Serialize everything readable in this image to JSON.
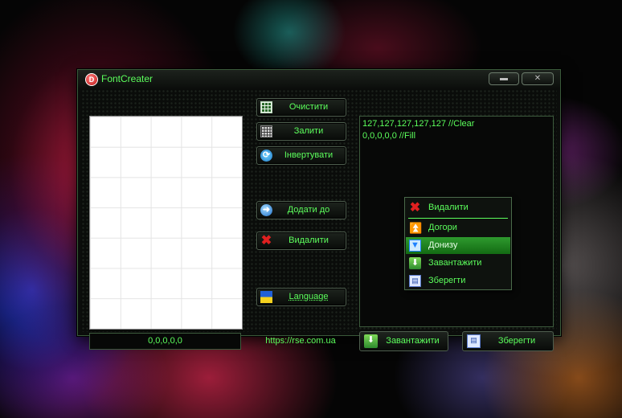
{
  "window": {
    "title": "FontCreater",
    "app_icon_glyph": "D",
    "minimize_glyph": "▬",
    "close_glyph": "✕"
  },
  "canvas": {
    "value": "0,0,0,0,0"
  },
  "buttons": {
    "clear": {
      "label": "Очистити",
      "icon": "table-icon"
    },
    "fill": {
      "label": "Залити",
      "icon": "grid-icon"
    },
    "invert": {
      "label": "Інвертувати",
      "icon": "refresh-icon"
    },
    "add_to": {
      "label": "Додати до",
      "icon": "arrow-right-icon"
    },
    "delete": {
      "label": "Видалити",
      "icon": "close-x-icon"
    },
    "language": {
      "label": "Language",
      "icon": "ukraine-flag-icon"
    }
  },
  "website": "https://rse.com.ua",
  "code": {
    "lines": [
      "127,127,127,127,127 //Clear",
      "0,0,0,0,0 //Fill"
    ]
  },
  "context_menu": {
    "items": [
      {
        "label": "Видалити",
        "icon": "close-x-icon"
      },
      {
        "label": "Догори",
        "icon": "move-up-icon"
      },
      {
        "label": "Донизу",
        "icon": "move-down-icon",
        "selected": true
      },
      {
        "label": "Завантажити",
        "icon": "download-icon"
      },
      {
        "label": "Зберегти",
        "icon": "save-icon"
      }
    ]
  },
  "bottom": {
    "load_label": "Завантажити",
    "save_label": "Зберегти"
  },
  "colors": {
    "accent_green": "#5cff5c",
    "selection_green": "#2e9a2e",
    "window_bg": "#0b0d0b"
  }
}
